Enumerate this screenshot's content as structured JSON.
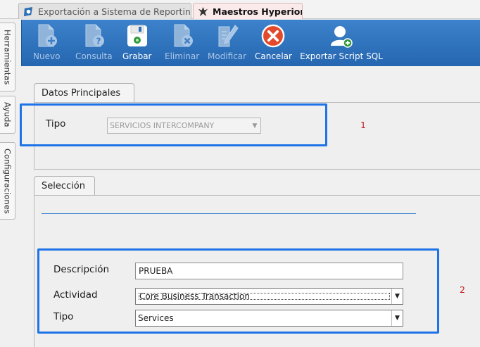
{
  "tabs": [
    {
      "label": "Exportación a Sistema de Reporting",
      "active": false
    },
    {
      "label": "Maestros Hyperion",
      "active": true
    }
  ],
  "side_tabs": [
    {
      "label": "Herramientas"
    },
    {
      "label": "Ayuda"
    },
    {
      "label": "Configuraciones"
    }
  ],
  "toolbar": {
    "nuevo": {
      "label": "Nuevo",
      "icon": "new-document-icon",
      "enabled": false
    },
    "consulta": {
      "label": "Consulta",
      "icon": "query-document-icon",
      "enabled": false
    },
    "grabar": {
      "label": "Grabar",
      "icon": "save-disk-icon",
      "enabled": true
    },
    "eliminar": {
      "label": "Eliminar",
      "icon": "delete-document-icon",
      "enabled": false
    },
    "modificar": {
      "label": "Modificar",
      "icon": "edit-pencil-icon",
      "enabled": false
    },
    "cancelar": {
      "label": "Cancelar",
      "icon": "cancel-x-icon",
      "enabled": true
    },
    "exportar": {
      "label": "Exportar Script SQL",
      "icon": "export-user-icon",
      "enabled": true
    }
  },
  "datos_principales": {
    "title": "Datos Principales",
    "tipo_label": "Tipo",
    "tipo_value": "SERVICIOS INTERCOMPANY"
  },
  "seleccion": {
    "title": "Selección",
    "descripcion_label": "Descripción",
    "descripcion_value": "PRUEBA",
    "actividad_label": "Actividad",
    "actividad_value": "Core Business Transaction",
    "tipo_label": "Tipo",
    "tipo_value": "Services"
  },
  "annotations": {
    "one": "1",
    "two": "2"
  },
  "colors": {
    "toolbar": "#2a6fba",
    "highlight": "#1e73e8",
    "note": "#c42020",
    "active_tab": "#fbeaea"
  }
}
